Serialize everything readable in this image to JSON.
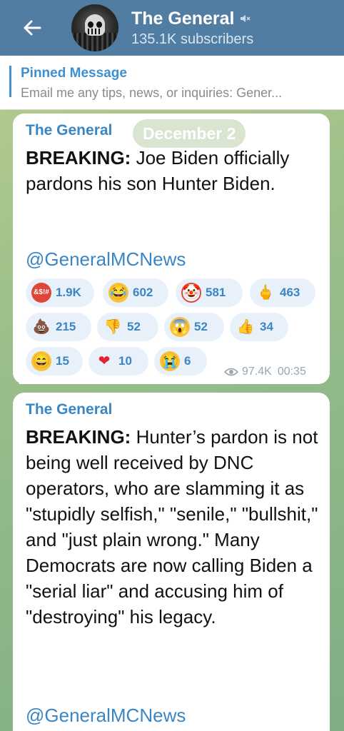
{
  "header": {
    "title": "The General",
    "subscribers": "135.1K subscribers"
  },
  "pinned": {
    "title": "Pinned Message",
    "text": "Email me any tips, news, or inquiries:  Gener..."
  },
  "date_pill": "December 2",
  "messages": [
    {
      "sender": "The General",
      "bold": "BREAKING:",
      "text": " Joe Biden officially pardons his son Hunter Biden.",
      "link": "@GeneralMCNews",
      "views": "97.4K",
      "time": "00:35",
      "reactions": [
        {
          "emoji": "angry-face",
          "count": "1.9K"
        },
        {
          "emoji": "rofl-face",
          "count": "602"
        },
        {
          "emoji": "clown-face",
          "count": "581"
        },
        {
          "emoji": "middle-finger",
          "count": "463"
        },
        {
          "emoji": "poop",
          "count": "215"
        },
        {
          "emoji": "thumbs-down",
          "count": "52"
        },
        {
          "emoji": "screaming-face",
          "count": "52"
        },
        {
          "emoji": "thumbs-up",
          "count": "34"
        },
        {
          "emoji": "grinning-face",
          "count": "15"
        },
        {
          "emoji": "red-heart",
          "count": "10"
        },
        {
          "emoji": "crying-face",
          "count": "6"
        }
      ]
    },
    {
      "sender": "The General",
      "bold": "BREAKING:",
      "text": " Hunter’s pardon is not being well received by DNC operators, who are slamming it as \"stupidly selfish,\" \"senile,\" \"bullshit,\" and \"just plain wrong.\" Many Democrats are now calling Biden a \"serial liar\" and accusing him of \"destroying\" his legacy.",
      "link": "@GeneralMCNews"
    }
  ],
  "colors": {
    "header_bg": "#517da2",
    "accent": "#3a86c4",
    "reaction_bg": "#e8f1fa"
  }
}
